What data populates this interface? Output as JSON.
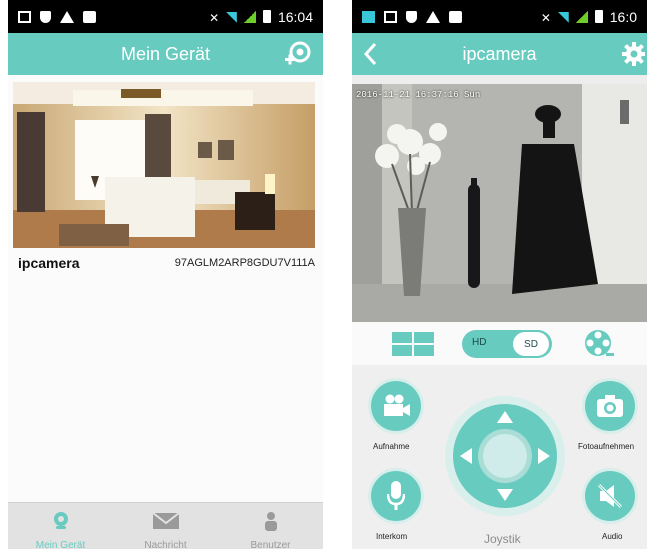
{
  "colors": {
    "accent": "#68cbc0",
    "statusbar": "#000000"
  },
  "phone1": {
    "status": {
      "time": "16:04"
    },
    "header": {
      "title": "Mein Gerät",
      "add_icon": "camera-add-icon"
    },
    "camera": {
      "name": "ipcamera",
      "uid": "97AGLM2ARP8GDU7V111A"
    },
    "tabs": [
      {
        "label": "Mein Gerät",
        "icon": "webcam-icon",
        "active": true
      },
      {
        "label": "Nachricht",
        "icon": "envelope-icon",
        "active": false
      },
      {
        "label": "Benutzer",
        "icon": "person-icon",
        "active": false
      }
    ]
  },
  "phone2": {
    "status": {
      "time": "16:0"
    },
    "header": {
      "title": "ipcamera",
      "back_icon": "back-arrow-icon",
      "settings_icon": "gear-icon"
    },
    "video": {
      "osd": "2016-11-21 16:37:16 Sun"
    },
    "quality": {
      "hd": "HD",
      "sd": "SD"
    },
    "controls": {
      "record": "Aufnahme",
      "photo": "Fotoaufnehmen",
      "intercom": "Interkom",
      "joystick": "Joystik",
      "audio": "Audio"
    }
  }
}
